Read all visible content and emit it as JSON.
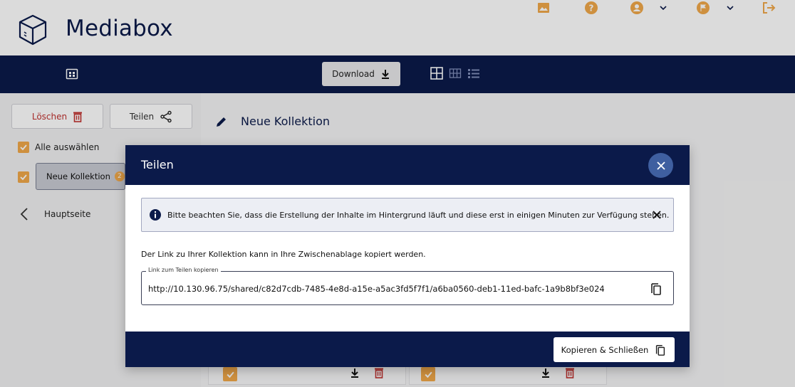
{
  "header": {
    "app_title": "Mediabox",
    "icons": [
      "gallery-icon",
      "help-icon",
      "user-icon",
      "chevron-down-icon",
      "language-icon",
      "chevron-down-icon",
      "logout-icon"
    ],
    "accent_color": "#f0a84a"
  },
  "toolbar": {
    "download_label": "Download",
    "view_modes": [
      "grid-large-icon",
      "grid-small-icon",
      "list-icon"
    ]
  },
  "sidebar": {
    "delete_label": "Löschen",
    "share_label": "Teilen",
    "select_all_label": "Alle auswählen",
    "collection": {
      "label": "Neue Kollektion",
      "count": "2"
    },
    "back_label": "Hauptseite"
  },
  "main": {
    "title": "Neue Kollektion"
  },
  "modal": {
    "title": "Teilen",
    "info_text": "Bitte beachten Sie, dass die Erstellung der Inhalte im Hintergrund läuft und diese erst in einigen Minuten zur Verfügung stehen.",
    "description": "Der Link zu Ihrer Kollektion kann in Ihre Zwischenablage kopiert werden.",
    "link_field_label": "Link zum Teilen kopieren",
    "link_value": "http://10.130.96.75/shared/c82d7cdb-7485-4e8d-a15e-a5ac3fd5f7f1/a6ba0560-deb1-11ed-bafc-1a9b8bf3e024",
    "copy_close_label": "Kopieren & Schließen"
  },
  "colors": {
    "navy": "#0b1a4a",
    "orange": "#f0a84a",
    "delete_red": "#c0322f"
  }
}
